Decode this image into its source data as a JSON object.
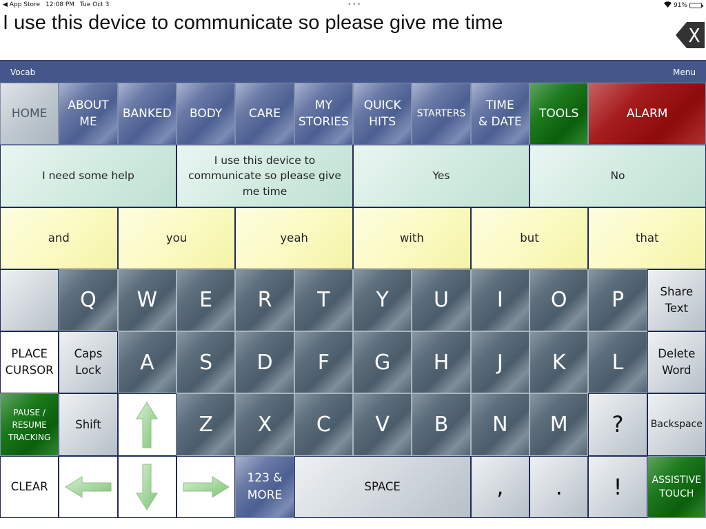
{
  "status_bar": {
    "back_app": "◀ App Store",
    "time": "12:08 PM",
    "date": "Tue Oct 3",
    "multitask_dots": "•••",
    "battery_percent": "91%",
    "battery_level": 0.91
  },
  "message_window": {
    "text": "I use this device to communicate so please give me time",
    "clear_icon": "backspace-x-icon"
  },
  "nav_bar": {
    "left_label": "Vocab",
    "right_label": "Menu"
  },
  "category_row": [
    {
      "label": "HOME"
    },
    {
      "label": "ABOUT\nME"
    },
    {
      "label": "BANKED"
    },
    {
      "label": "BODY"
    },
    {
      "label": "CARE"
    },
    {
      "label": "MY\nSTORIES"
    },
    {
      "label": "QUICK\nHITS"
    },
    {
      "label": "STARTERS"
    },
    {
      "label": "TIME\n& DATE"
    },
    {
      "label": "TOOLS"
    },
    {
      "label": "ALARM"
    }
  ],
  "phrases": [
    "I need some help",
    "I use this device to communicate so please give me time",
    "Yes",
    "No"
  ],
  "words": [
    "and",
    "you",
    "yeah",
    "with",
    "but",
    "that"
  ],
  "keyboard": {
    "row1": [
      "Q",
      "W",
      "E",
      "R",
      "T",
      "Y",
      "U",
      "I",
      "O",
      "P"
    ],
    "row2": [
      "A",
      "S",
      "D",
      "F",
      "G",
      "H",
      "J",
      "K",
      "L"
    ],
    "row3": [
      "Z",
      "X",
      "C",
      "V",
      "B",
      "N",
      "M"
    ],
    "share_text": "Share\nText",
    "place_cursor": "PLACE\nCURSOR",
    "caps_lock": "Caps\nLock",
    "delete_word": "Delete\nWord",
    "pause_tracking": "PAUSE /\nRESUME\nTRACKING",
    "shift": "Shift",
    "question": "?",
    "backspace": "Backspace",
    "clear": "CLEAR",
    "more": "123 &\nMORE",
    "space": "SPACE",
    "comma": ",",
    "period": ".",
    "exclamation": "!",
    "assistive_touch": "ASSISTIVE\nTOUCH"
  },
  "colors": {
    "nav_bar": "#44568a",
    "category_blue": "#4c5f92",
    "tools_green": "#0b5e0b",
    "alarm_red": "#8d0b0b",
    "phrase_mint": "#d2ebe1",
    "word_yellow": "#fbfbc4",
    "letter_key": "#4b5c6a",
    "arrow_green": "#8fcf8a"
  }
}
